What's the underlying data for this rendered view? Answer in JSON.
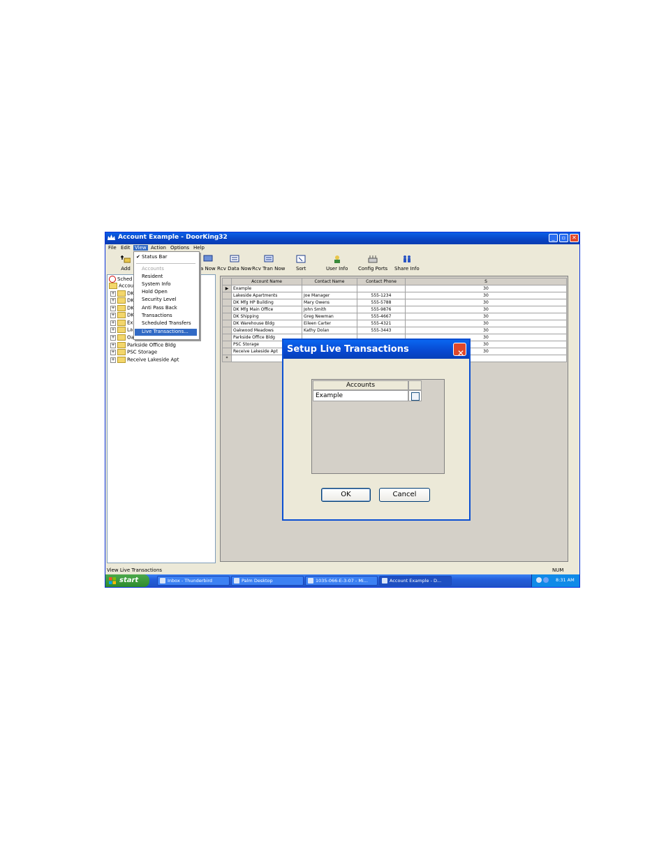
{
  "window": {
    "title": "Account Example - DoorKing32",
    "controls": {
      "minimize": "_",
      "maximize": "▫",
      "close": "✕"
    }
  },
  "menubar": [
    "File",
    "Edit",
    "View",
    "Action",
    "Options",
    "Help"
  ],
  "toolbar": [
    {
      "label": "Add",
      "icon": "add-icon"
    },
    {
      "label": "a Now",
      "icon": "send-data-icon"
    },
    {
      "label": "Rcv Data Now",
      "icon": "receive-data-icon"
    },
    {
      "label": "Rcv Tran Now",
      "icon": "receive-transactions-icon"
    },
    {
      "label": "Sort",
      "icon": "sort-icon"
    },
    {
      "label": "User Info",
      "icon": "user-info-icon"
    },
    {
      "label": "Config Ports",
      "icon": "config-ports-icon"
    },
    {
      "label": "Share Info",
      "icon": "share-info-icon"
    }
  ],
  "view_menu": {
    "status_bar": "Status Bar",
    "items": [
      "Accounts",
      "Resident",
      "System Info",
      "Hold Open",
      "Security Level",
      "Anti Pass Back",
      "Transactions",
      "Scheduled Transfers",
      "Live Transactions..."
    ]
  },
  "tree": {
    "items": [
      "Sched",
      "Accoun",
      "DK",
      "DK",
      "DK",
      "DK",
      "Ex",
      "La",
      "Oa",
      "Parkside Office Bldg",
      "PSC Storage",
      "Receive Lakeside Apt"
    ]
  },
  "grid": {
    "columns": [
      "Account Name",
      "Contact Name",
      "Contact Phone",
      "S"
    ],
    "rows": [
      [
        "Example",
        "",
        "",
        "30"
      ],
      [
        "Lakeside Apartments",
        "Joe Manager",
        "555-1234",
        "30"
      ],
      [
        "DK Mfg HP Building",
        "Mary Owens",
        "555-5788",
        "30"
      ],
      [
        "DK Mfg Main Office",
        "John Smith",
        "555-9876",
        "30"
      ],
      [
        "DK Shipping",
        "Greg Newman",
        "555-4667",
        "30"
      ],
      [
        "DK Warehouse Bldg",
        "Eileen Carter",
        "555-4321",
        "30"
      ],
      [
        "Oakwood Meadows",
        "Kathy Dolan",
        "555-3443",
        "30"
      ],
      [
        "Parkside Office Bldg",
        "",
        "",
        "30"
      ],
      [
        "PSC Storage",
        "",
        "",
        "30"
      ],
      [
        "Receive Lakeside Apt",
        "",
        "",
        "30"
      ]
    ],
    "new_row_marker": "*",
    "current_row_marker": "▶"
  },
  "status_bar": {
    "text": "View Live Transactions",
    "num": "NUM"
  },
  "taskbar": {
    "start": "start",
    "tasks": [
      "Inbox - Thunderbird",
      "Palm Desktop",
      "1035-066-E-3-07 - Mi...",
      "Account Example - D..."
    ],
    "time": "8:31 AM"
  },
  "dialog": {
    "title": "Setup Live Transactions",
    "list_header": "Accounts",
    "list_rows": [
      "Example"
    ],
    "ok": "OK",
    "cancel": "Cancel"
  }
}
